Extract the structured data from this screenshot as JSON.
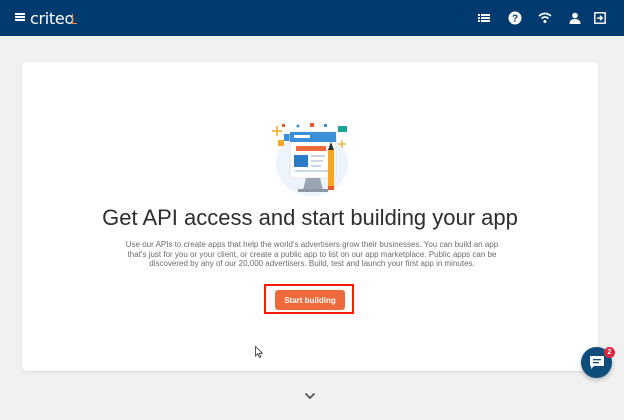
{
  "app": {
    "brand": "criteo",
    "icons": {
      "menu": "hamburger-menu-icon",
      "list": "list-icon",
      "help": "question-circle-icon",
      "signal": "wifi-icon",
      "account": "user-icon",
      "logout": "logout-icon",
      "chat": "chat-bubble-icon",
      "more": "chevron-down-icon"
    }
  },
  "colors": {
    "topbar": "#003a6e",
    "accent": "#ef6a3a",
    "highlight": "#ff1a00",
    "chat": "#0e4c7b",
    "badge": "#e2263b"
  },
  "card": {
    "heading": "Get API access and start building your app",
    "description_line1": "Use our APIs to create apps that help the world's advertisers grow their businesses. You can build an app",
    "description_line2": "that's just for you or your client, or create a public app to list on our app marketplace. Public apps can be",
    "description_line3": "discovered by any of our 20,000 advertisers. Build, test and launch your first app in minutes.",
    "button_label": "Start building"
  },
  "chat": {
    "badge": "2"
  }
}
